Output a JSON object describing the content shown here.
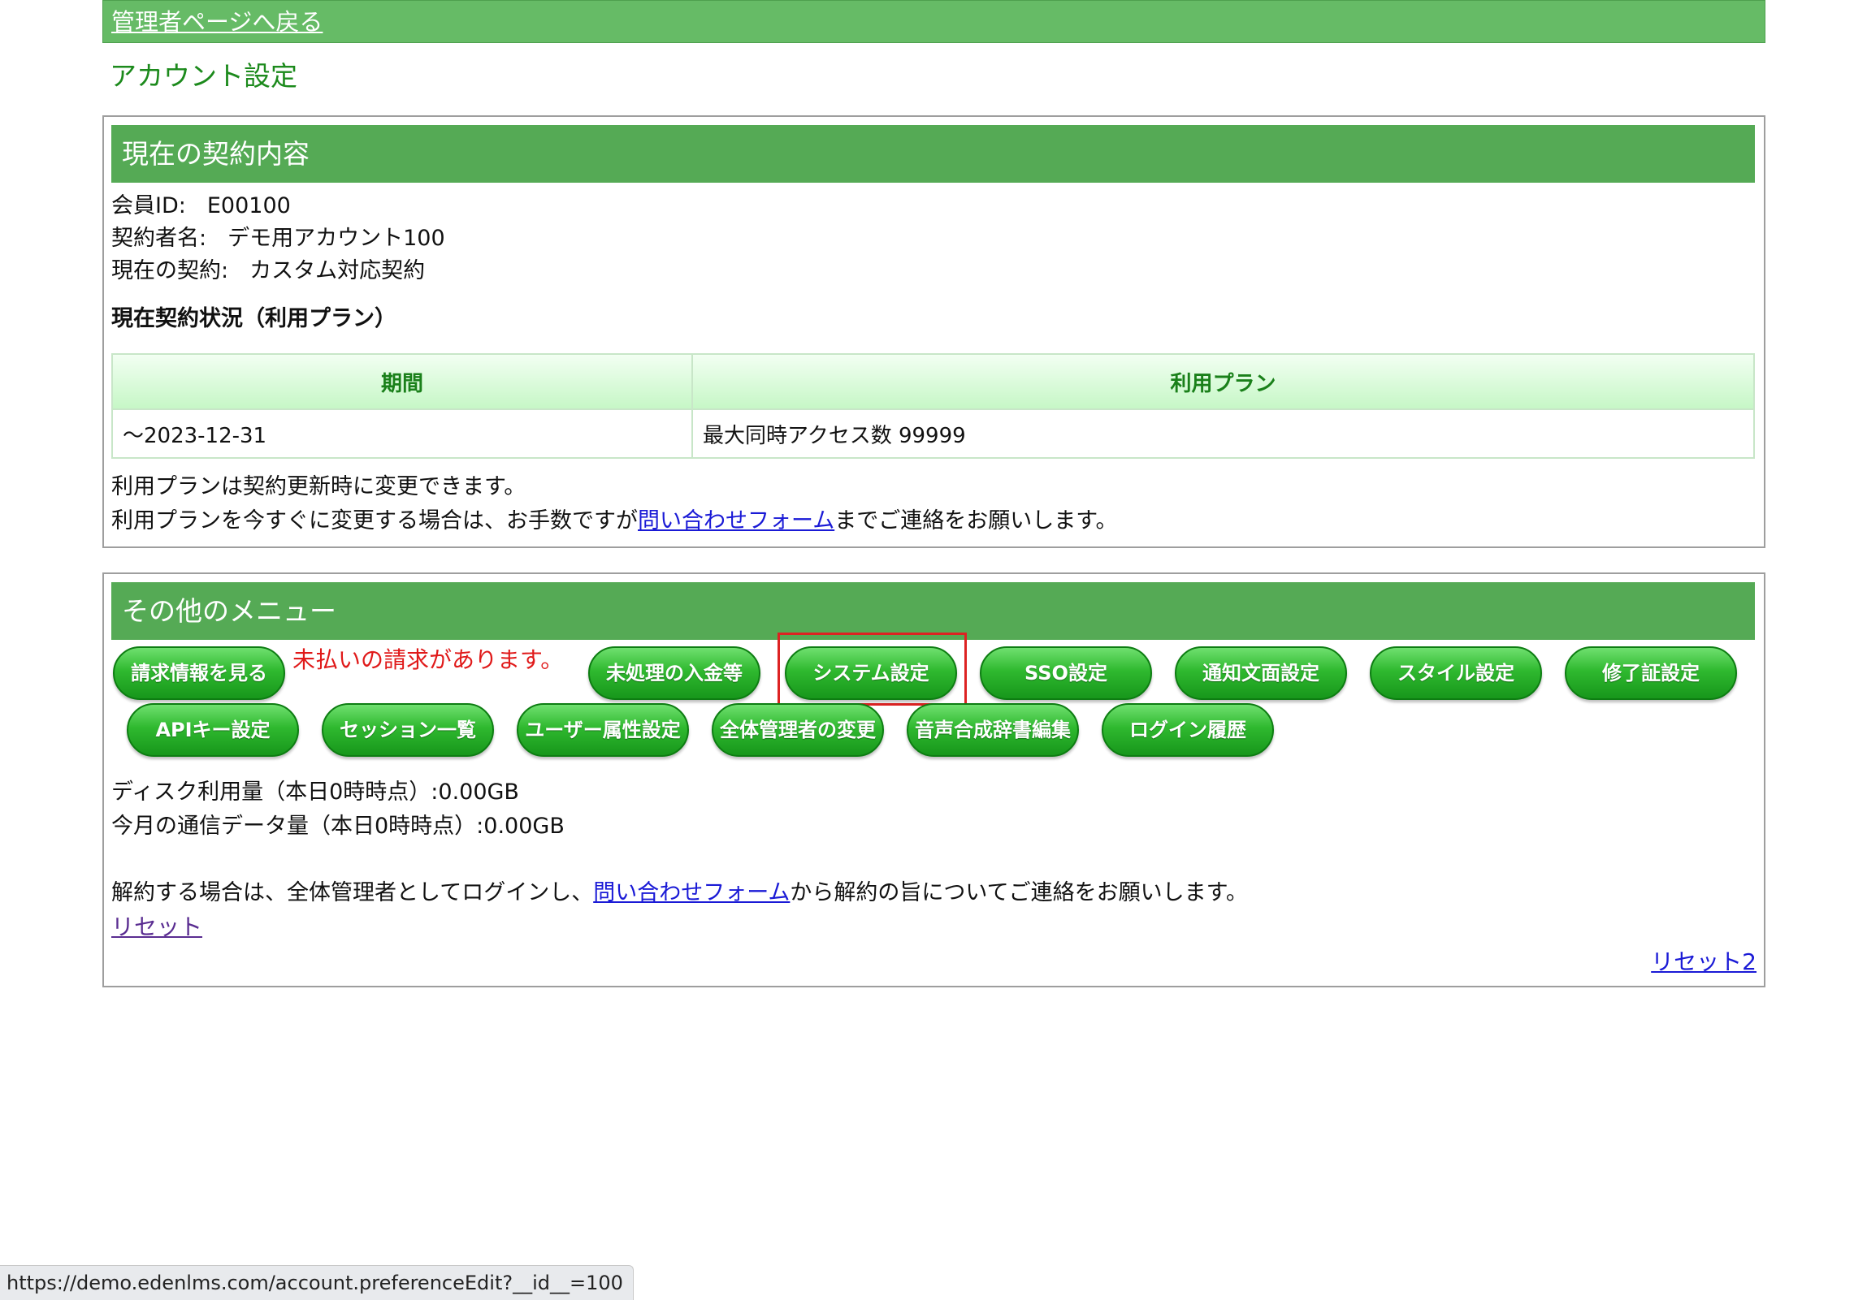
{
  "topbar": {
    "back_link": "管理者ページへ戻る"
  },
  "page_title": "アカウント設定",
  "contract": {
    "heading": "現在の契約内容",
    "member_id_label": "会員ID:",
    "member_id_value": "E00100",
    "contractor_label": "契約者名:",
    "contractor_value": "デモ用アカウント100",
    "current_contract_label": "現在の契約:",
    "current_contract_value": "カスタム対応契約",
    "status_heading": "現在契約状況（利用プラン）",
    "table": {
      "headers": [
        "期間",
        "利用プラン"
      ],
      "rows": [
        [
          "～2023-12-31",
          "最大同時アクセス数 99999"
        ]
      ]
    },
    "note1": "利用プランは契約更新時に変更できます。",
    "note2_before": "利用プランを今すぐに変更する場合は、お手数ですが",
    "note2_link": "問い合わせフォーム",
    "note2_after": "までご連絡をお願いします。"
  },
  "menu": {
    "heading": "その他のメニュー",
    "billing_button": "請求情報を見る",
    "unpaid_warning": "未払いの請求があります。",
    "buttons_row1": [
      "未処理の入金等",
      "システム設定",
      "SSO設定",
      "通知文面設定",
      "スタイル設定",
      "修了証設定"
    ],
    "buttons_row2": [
      "APIキー設定",
      "セッション一覧",
      "ユーザー属性設定",
      "全体管理者の変更",
      "音声合成辞書編集",
      "ログイン履歴"
    ],
    "disk_usage": "ディスク利用量（本日0時時点）:0.00GB",
    "traffic": "今月の通信データ量（本日0時時点）:0.00GB",
    "cancel_before": "解約する場合は、全体管理者としてログインし、",
    "cancel_link": "問い合わせフォーム",
    "cancel_after": "から解約の旨についてご連絡をお願いします。",
    "reset_link": "リセット",
    "reset2_link": "リセット2"
  },
  "status_bar": {
    "url": "https://demo.edenlms.com/account.preferenceEdit?__id__=100"
  },
  "colors": {
    "header_green": "#55aa55",
    "topbar_green": "#66bb66",
    "highlight_red": "#dd2222",
    "warning_red": "#e01a1a"
  }
}
